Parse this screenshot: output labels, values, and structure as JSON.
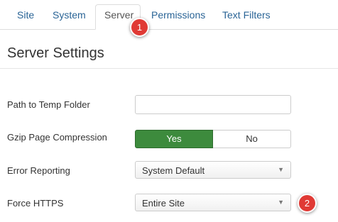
{
  "tabs": {
    "site": "Site",
    "system": "System",
    "server": "Server",
    "permissions": "Permissions",
    "text_filters": "Text Filters"
  },
  "badges": {
    "one": "1",
    "two": "2"
  },
  "section": {
    "title": "Server Settings"
  },
  "fields": {
    "temp_folder": {
      "label": "Path to Temp Folder",
      "value": ""
    },
    "gzip": {
      "label": "Gzip Page Compression",
      "yes": "Yes",
      "no": "No",
      "selected": "Yes"
    },
    "error_reporting": {
      "label": "Error Reporting",
      "value": "System Default"
    },
    "force_https": {
      "label": "Force HTTPS",
      "value": "Entire Site"
    }
  },
  "icons": {
    "select_caret": "caret-down-icon"
  },
  "colors": {
    "tab_link": "#2a6496",
    "yes_active": "#3d8b3d",
    "badge": "#e03a35"
  }
}
